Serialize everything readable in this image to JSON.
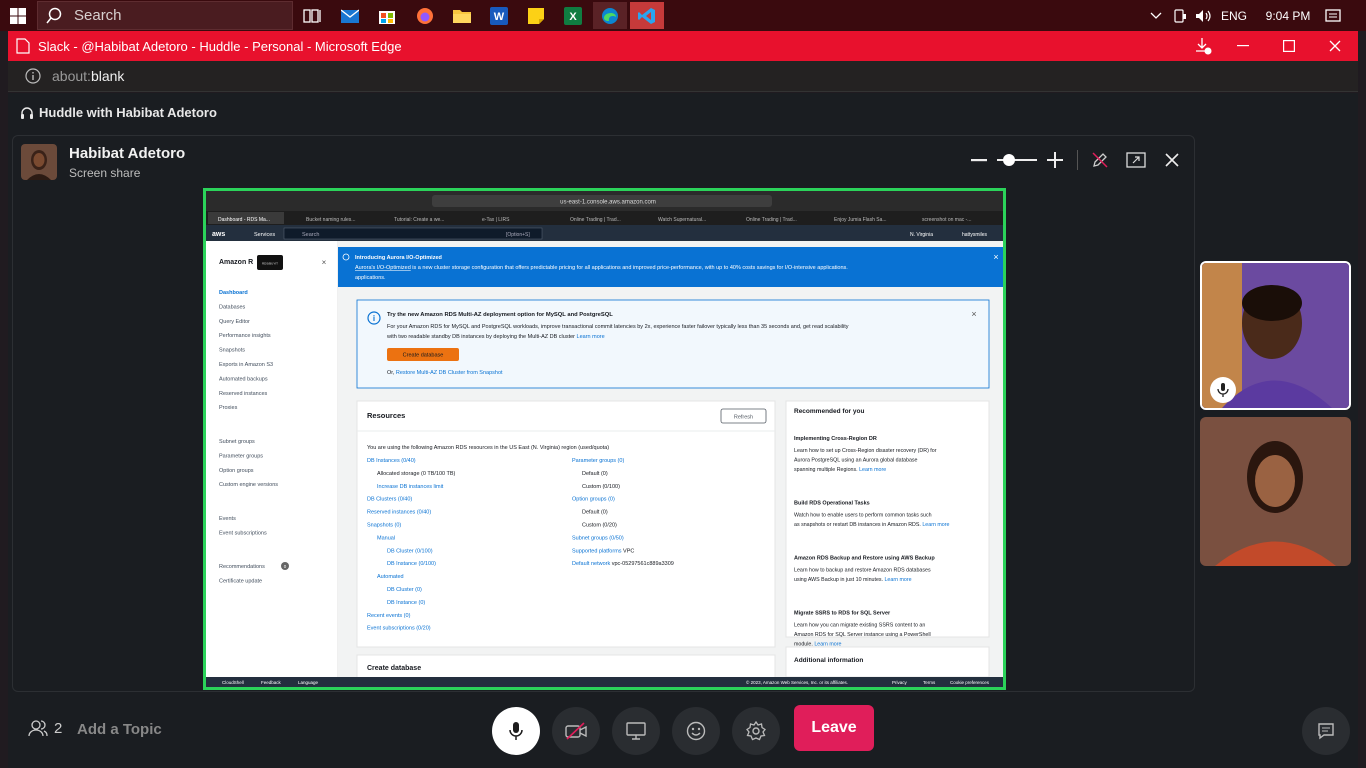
{
  "taskbar": {
    "search_placeholder": "Search",
    "apps": [
      "task-view",
      "outlook",
      "store",
      "firefox",
      "file-explorer",
      "word",
      "sticky-notes",
      "excel",
      "edge",
      "vscode"
    ],
    "language": "ENG",
    "time": "9:04 PM"
  },
  "edge": {
    "window_title": "Slack - @Habibat Adetoro - Huddle - Personal - Microsoft Edge",
    "url_scheme": "about:",
    "url_path": "blank"
  },
  "huddle": {
    "title": "Huddle with Habibat Adetoro",
    "presenter_name": "Habibat Adetoro",
    "presenter_sub": "Screen share",
    "participant_count": "2",
    "topic_placeholder": "Add a Topic",
    "leave_label": "Leave",
    "zoom_level": 0.3
  },
  "aws": {
    "address": "us-east-1.console.aws.amazon.com",
    "tabs": [
      "Dashboard - RDS Ma...",
      "Bucket naming rules...",
      "Tutorial: Create a we...",
      "e-Tax | LIRS",
      "Online Trading | Trad...",
      "Watch Supernatural...",
      "Online Trading | Trad...",
      "Enjoy Jumia Flash Sa...",
      "screenshot on mac -..."
    ],
    "topnav": {
      "services": "Services",
      "search": "Search",
      "shortcut": "[Option+S]",
      "region": "N. Virginia",
      "user": "hattysmiles"
    },
    "sidebar": {
      "brand": "Amazon R",
      "tooltip": "RDS/BUYIT",
      "items": [
        "Dashboard",
        "Databases",
        "Query Editor",
        "Performance insights",
        "Snapshots",
        "Exports in Amazon S3",
        "Automated backups",
        "Reserved instances",
        "Proxies"
      ],
      "items2": [
        "Subnet groups",
        "Parameter groups",
        "Option groups",
        "Custom engine versions"
      ],
      "items3": [
        "Events",
        "Event subscriptions"
      ],
      "items4": [
        "Recommendations",
        "Certificate update"
      ],
      "rec_badge": "0"
    },
    "banner": {
      "title": "Introducing Aurora I/O-Optimized",
      "link": "Aurora's I/O-Optimized",
      "text": " is a new cluster storage configuration that offers predictable pricing for all applications and improved price-performance, with up to 40% costs savings for I/O-intensive applications."
    },
    "multiaz": {
      "title": "Try the new Amazon RDS Multi-AZ deployment option for MySQL and PostgreSQL",
      "text1": "For your Amazon RDS for MySQL and PostgreSQL workloads, improve transactional commit latencies by 2x, experience faster failover typically less than 35 seconds and, get read scalability",
      "text2": "with two readable standby DB instances by deploying the Multi-AZ DB cluster",
      "learn": "Learn more",
      "button": "Create database",
      "or": "Or,",
      "restore": "Restore Multi-AZ DB Cluster from Snapshot"
    },
    "resources": {
      "title": "Resources",
      "refresh": "Refresh",
      "intro": "You are using the following Amazon RDS resources in the US East (N. Virginia) region (used/quota)",
      "left": [
        {
          "t": "DB Instances (0/40)",
          "link": true,
          "ind": 0
        },
        {
          "t": "Allocated storage (0 TB/100 TB)",
          "link": false,
          "ind": 1
        },
        {
          "t": "Increase DB instances limit",
          "link": true,
          "ind": 1
        },
        {
          "t": "DB Clusters (0/40)",
          "link": true,
          "ind": 0
        },
        {
          "t": "Reserved instances (0/40)",
          "link": true,
          "ind": 0
        },
        {
          "t": "Snapshots (0)",
          "link": true,
          "ind": 0
        },
        {
          "t": "Manual",
          "link": true,
          "ind": 1
        },
        {
          "t": "DB Cluster (0/100)",
          "link": true,
          "ind": 2
        },
        {
          "t": "DB Instance (0/100)",
          "link": true,
          "ind": 2
        },
        {
          "t": "Automated",
          "link": true,
          "ind": 1
        },
        {
          "t": "DB Cluster (0)",
          "link": true,
          "ind": 2
        },
        {
          "t": "DB Instance (0)",
          "link": true,
          "ind": 2
        },
        {
          "t": "Recent events (0)",
          "link": true,
          "ind": 0
        },
        {
          "t": "Event subscriptions (0/20)",
          "link": true,
          "ind": 0
        }
      ],
      "right": [
        {
          "t": "Parameter groups (0)",
          "link": true,
          "ind": 0
        },
        {
          "t": "Default (0)",
          "link": false,
          "ind": 1
        },
        {
          "t": "Custom (0/100)",
          "link": false,
          "ind": 1
        },
        {
          "t": "Option groups (0)",
          "link": true,
          "ind": 0
        },
        {
          "t": "Default (0)",
          "link": false,
          "ind": 1
        },
        {
          "t": "Custom (0/20)",
          "link": false,
          "ind": 1
        },
        {
          "t": "Subnet groups (0/50)",
          "link": true,
          "ind": 0
        },
        {
          "t": "Supported platforms",
          "link": true,
          "ind": 0,
          "suffix": " VPC"
        },
        {
          "t": "Default network",
          "link": true,
          "ind": 0,
          "suffix": " vpc-05297561c889a3309"
        }
      ]
    },
    "recommended": {
      "title": "Recommended for you",
      "items": [
        {
          "h": "Implementing Cross-Region DR",
          "lines": [
            "Learn how to set up Cross-Region disaster recovery (DR) for",
            "Aurora PostgreSQL using an Aurora global database",
            "spanning multiple Regions. "
          ],
          "learn": "Learn more"
        },
        {
          "h": "Build RDS Operational Tasks",
          "lines": [
            "Watch how to enable users to perform common tasks such",
            "as snapshots or restart DB instances in Amazon RDS. "
          ],
          "learn": "Learn more"
        },
        {
          "h": "Amazon RDS Backup and Restore using AWS Backup",
          "lines": [
            "Learn how to backup and restore Amazon RDS databases",
            "using AWS Backup in just 10 minutes. "
          ],
          "learn": "Learn more"
        },
        {
          "h": "Migrate SSRS to RDS for SQL Server",
          "lines": [
            "Learn how you can migrate existing SSRS content to an",
            "Amazon RDS for SQL Server instance using a PowerShell",
            "module. "
          ],
          "learn": "Learn more"
        }
      ]
    },
    "create_db_heading": "Create database",
    "additional_info": "Additional information",
    "footer": {
      "cloudshell": "CloudShell",
      "feedback": "Feedback",
      "language": "Language",
      "copyright": "© 2023, Amazon Web Services, Inc. or its affiliates.",
      "privacy": "Privacy",
      "terms": "Terms",
      "cookies": "Cookie preferences"
    }
  },
  "colors": {
    "taskbar": "#3a0a0e",
    "edge_titlebar": "#e8112d",
    "share_border": "#2bd35a",
    "leave": "#e01e5a",
    "aws_banner": "#0972d3",
    "aws_nav": "#232f3e",
    "aws_button": "#ec7211"
  }
}
